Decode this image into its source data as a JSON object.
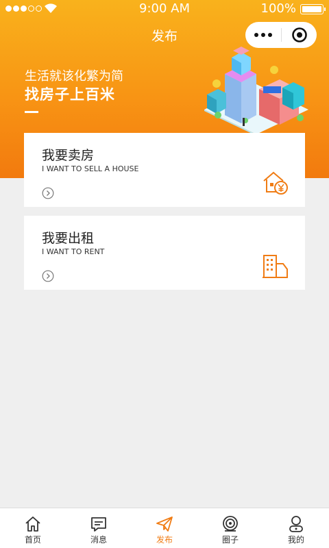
{
  "status_bar": {
    "time": "9:00 AM",
    "battery": "100%"
  },
  "nav": {
    "title": "发布"
  },
  "banner": {
    "line1": "生活就该化繁为简",
    "line2": "找房子上百米"
  },
  "cards": [
    {
      "title": "我要卖房",
      "subtitle": "I WANT TO SELL A HOUSE",
      "icon": "house-yen-icon"
    },
    {
      "title": "我要出租",
      "subtitle": "I WANT TO RENT",
      "icon": "buildings-icon"
    }
  ],
  "tabs": [
    {
      "label": "首页",
      "icon": "home-icon",
      "active": false
    },
    {
      "label": "消息",
      "icon": "message-icon",
      "active": false
    },
    {
      "label": "发布",
      "icon": "send-icon",
      "active": true
    },
    {
      "label": "圈子",
      "icon": "circle-icon",
      "active": false
    },
    {
      "label": "我的",
      "icon": "profile-icon",
      "active": false
    }
  ],
  "colors": {
    "accent": "#f07c14",
    "header_top": "#f9b21c",
    "header_bottom": "#f27a0e",
    "background": "#efefef"
  }
}
